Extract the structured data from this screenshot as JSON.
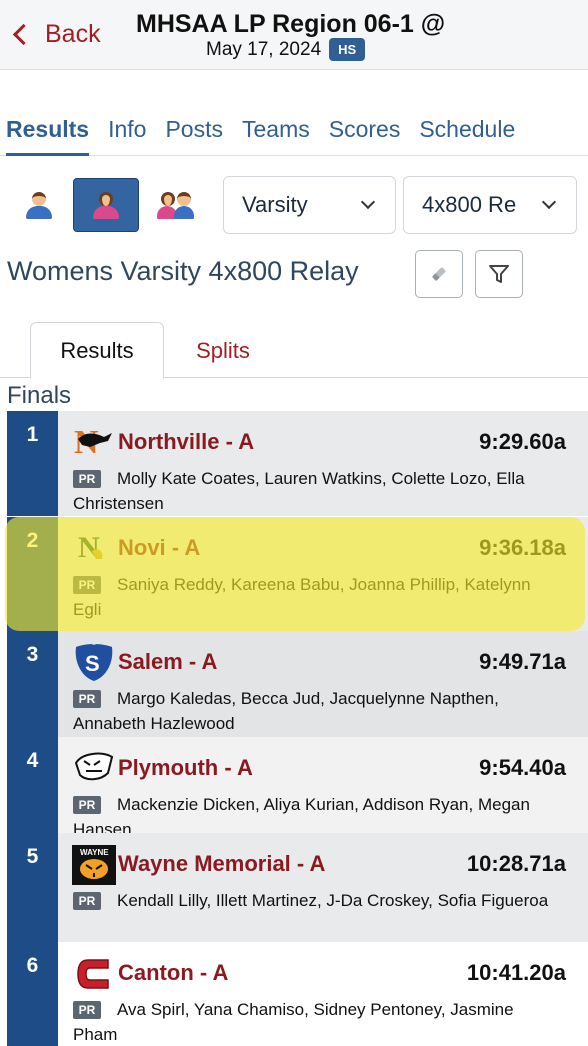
{
  "header": {
    "back_label": "Back",
    "title": "MHSAA LP Region 06-1 @",
    "date": "May 17, 2024",
    "level_badge": "HS"
  },
  "tabs": [
    "Results",
    "Info",
    "Posts",
    "Teams",
    "Scores",
    "Schedule"
  ],
  "filters": {
    "gender_icons": [
      "boys-icon",
      "girls-icon",
      "mixed-icon"
    ],
    "selected_gender": "girls",
    "level": "Varsity",
    "event": "4x800 Re"
  },
  "event_title": "Womens Varsity 4x800 Relay",
  "subtabs": {
    "results": "Results",
    "splits": "Splits"
  },
  "section_label": "Finals",
  "pr_label": "PR",
  "colors": {
    "primary_blue": "#2f5f93",
    "place_blue": "#1e4c87",
    "team_red": "#8a1a1f",
    "highlight": "#f5ec28"
  },
  "results": [
    {
      "place": "1",
      "team": "Northville - A",
      "time": "9:29.60a",
      "athletes": "Molly Kate Coates, Lauren Watkins, Colette Lozo, Ella Christensen",
      "logo": "northville-mustang-logo"
    },
    {
      "place": "2",
      "team": "Novi - A",
      "time": "9:36.18a",
      "athletes": "Saniya Reddy, Kareena Babu, Joanna Phillip, Katelynn Egli",
      "logo": "novi-logo"
    },
    {
      "place": "3",
      "team": "Salem - A",
      "time": "9:49.71a",
      "athletes": "Margo Kaledas, Becca Jud, Jacquelynne Napthen, Annabeth Hazlewood",
      "logo": "salem-logo"
    },
    {
      "place": "4",
      "team": "Plymouth - A",
      "time": "9:54.40a",
      "athletes": "Mackenzie Dicken, Aliya Kurian, Addison Ryan, Megan Hansen",
      "logo": "plymouth-wildcat-logo"
    },
    {
      "place": "5",
      "team": "Wayne Memorial - A",
      "time": "10:28.71a",
      "athletes": "Kendall Lilly, Illett Martinez, J-Da Croskey, Sofia Figueroa",
      "logo": "wayne-tiger-logo"
    },
    {
      "place": "6",
      "team": "Canton - A",
      "time": "10:41.20a",
      "athletes": "Ava Spirl, Yana Chamiso, Sidney Pentoney, Jasmine Pham",
      "logo": "canton-c-logo"
    }
  ]
}
